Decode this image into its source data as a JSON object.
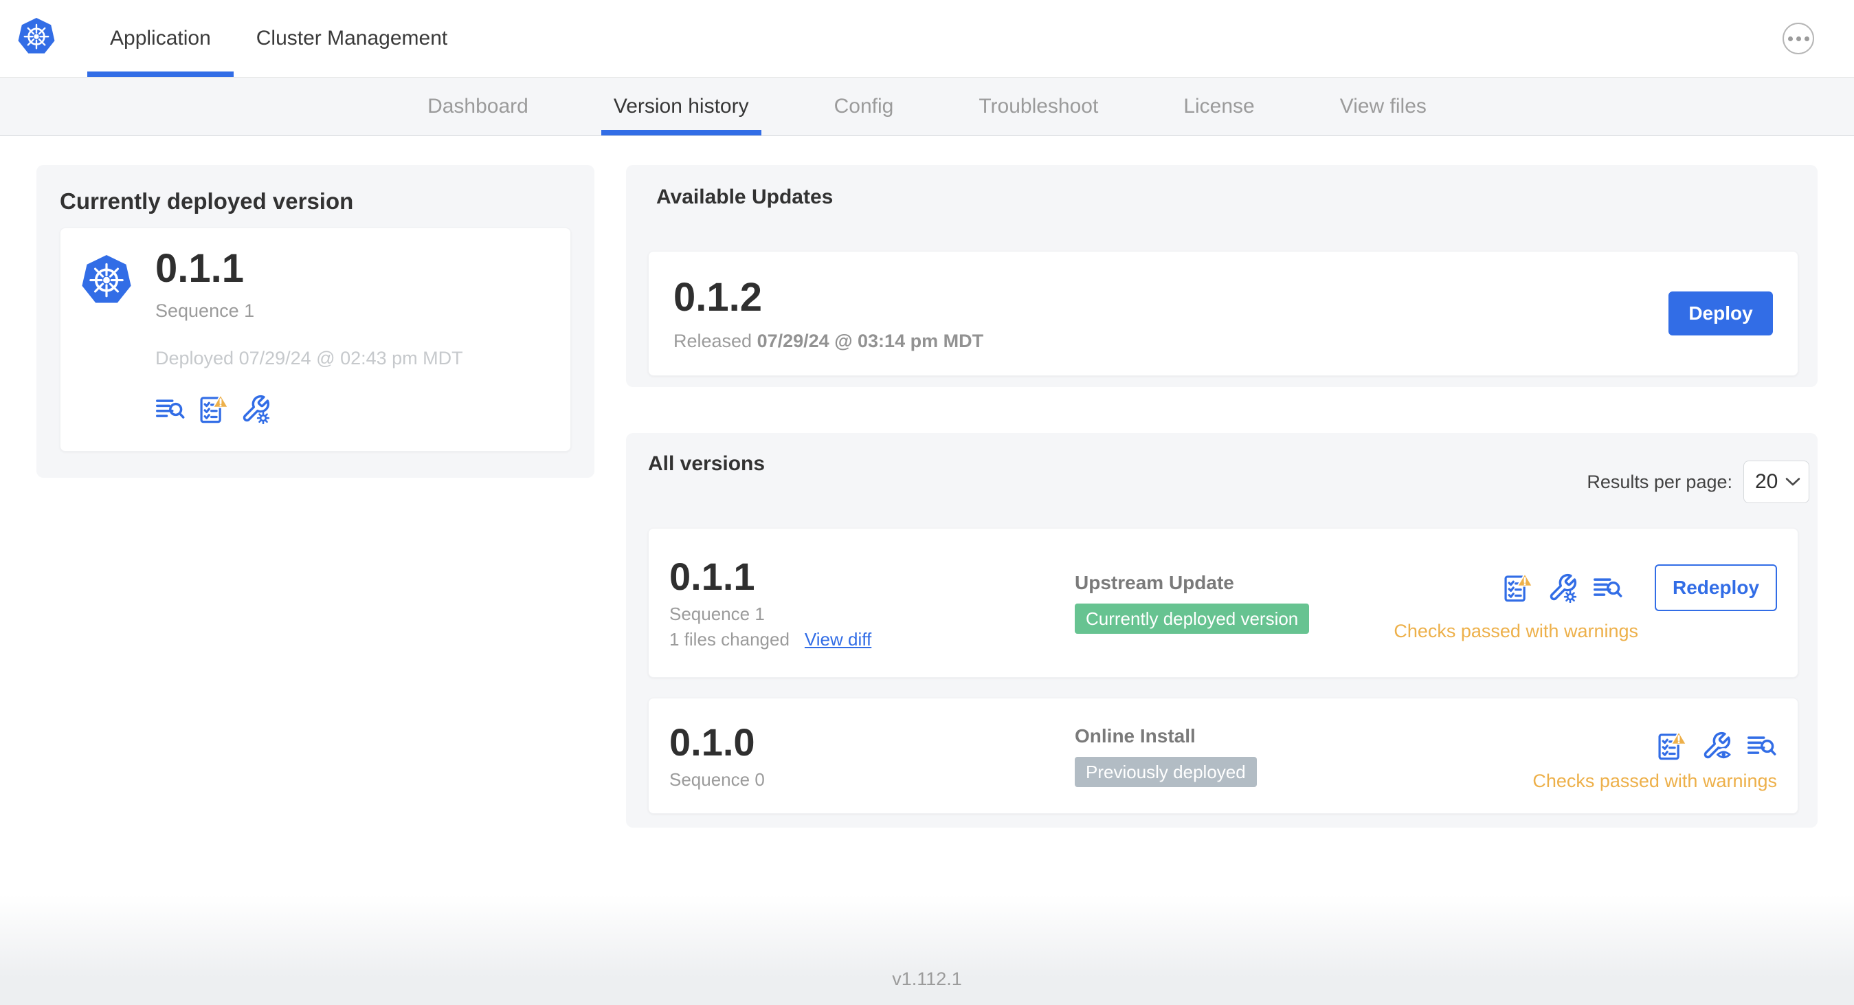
{
  "topbar": {
    "app_tab": "Application",
    "cluster_tab": "Cluster Management",
    "menu_icon": "ellipsis-menu-icon"
  },
  "subnav": {
    "tabs": [
      "Dashboard",
      "Version history",
      "Config",
      "Troubleshoot",
      "License",
      "View files"
    ],
    "active_tab": "Version history"
  },
  "current_card": {
    "title": "Currently deployed version",
    "version": "0.1.1",
    "sequence": "Sequence 1",
    "deployed": "Deployed 07/29/24 @ 02:43 pm MDT",
    "icons": [
      "logs-icon",
      "preflight-warning-icon",
      "config-gear-icon"
    ]
  },
  "updates_card": {
    "title": "Available Updates",
    "version": "0.1.2",
    "released_label": "Released",
    "released_date": "07/29/24 @ 03:14 pm MDT",
    "deploy_button": "Deploy"
  },
  "versions_card": {
    "title": "All versions",
    "results_label": "Results per page:",
    "results_value": "20",
    "rows": [
      {
        "version": "0.1.1",
        "sequence": "Sequence 1",
        "files_changed": "1 files changed",
        "view_diff": "View diff",
        "source": "Upstream Update",
        "status_badge": "Currently deployed version",
        "status_color": "#67C391",
        "checks": "Checks passed with warnings",
        "action_button": "Redeploy",
        "icons": [
          "preflight-warning-icon",
          "config-gear-icon",
          "logs-icon"
        ]
      },
      {
        "version": "0.1.0",
        "sequence": "Sequence 0",
        "source": "Online Install",
        "status_badge": "Previously deployed",
        "status_color": "#B2BCC4",
        "checks": "Checks passed with warnings",
        "icons": [
          "preflight-warning-icon",
          "config-view-icon",
          "logs-icon"
        ]
      }
    ]
  },
  "footer": {
    "app_version": "v1.112.1"
  },
  "colors": {
    "accent_blue": "#326DE6",
    "warning_amber": "#EDB04A",
    "success_green": "#67C391",
    "muted_badge_gray": "#B2BCC4"
  }
}
